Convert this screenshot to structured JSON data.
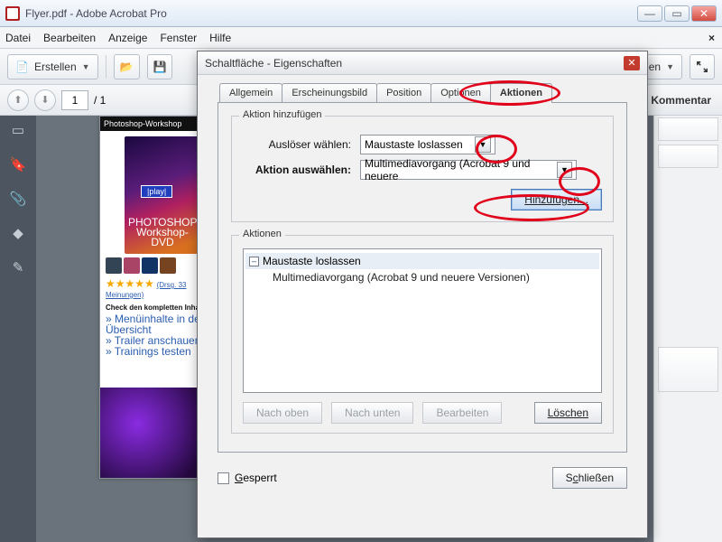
{
  "window": {
    "title": "Flyer.pdf - Adobe Acrobat Pro"
  },
  "menu": {
    "file": "Datei",
    "edit": "Bearbeiten",
    "view": "Anzeige",
    "window": "Fenster",
    "help": "Hilfe"
  },
  "toolbar": {
    "create": "Erstellen",
    "right_btn": "en"
  },
  "nav": {
    "page": "1",
    "total": "/  1"
  },
  "rightpanel": {
    "header": "Kommentar"
  },
  "doc": {
    "header": "Photoshop-Workshop",
    "play": "|play|",
    "cover_line1": "PHOTOSHOP",
    "cover_line2": "Workshop-DVD",
    "stars": "★★★★★",
    "ratings": "(Drsg. 33 Meinungen)",
    "check_header": "Check den kompletten Inhalt!",
    "link1": "» Menüinhalte in der Übersicht",
    "link2": "» Trailer anschauen",
    "link3": "» Trainings testen"
  },
  "dialog": {
    "title": "Schaltfläche - Eigenschaften",
    "tabs": {
      "general": "Allgemein",
      "appearance": "Erscheinungsbild",
      "position": "Position",
      "options": "Optionen",
      "actions": "Aktionen"
    },
    "grp_add": "Aktion hinzufügen",
    "lbl_trigger": "Auslöser wählen:",
    "val_trigger": "Maustaste loslassen",
    "lbl_action": "Aktion auswählen:",
    "val_action": "Multimediavorgang (Acrobat 9 und neuere",
    "btn_add": "Hinzufügen...",
    "grp_actions": "Aktionen",
    "list_header": "Maustaste loslassen",
    "list_item": "Multimediavorgang (Acrobat 9 und neuere Versionen)",
    "btn_up": "Nach oben",
    "btn_down": "Nach unten",
    "btn_edit": "Bearbeiten",
    "btn_del": "Löschen",
    "locked": "Gesperrt",
    "close": "Schließen"
  }
}
